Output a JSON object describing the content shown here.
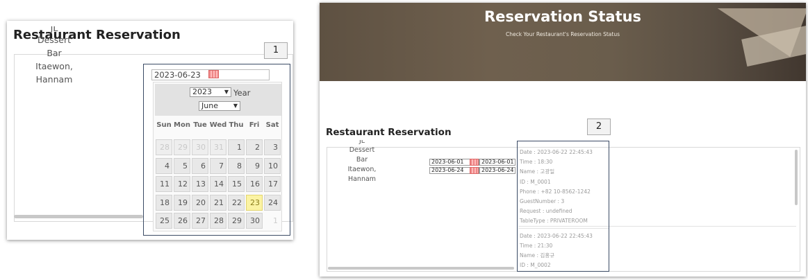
{
  "left_panel": {
    "title": "Restaurant Reservation",
    "restaurant_lines": [
      "JL",
      "Dessert",
      "Bar",
      "Itaewon,",
      "Hannam"
    ],
    "date_value": "2023-06-23",
    "callout": "1",
    "datepicker": {
      "year": "2023",
      "year_label": "Year",
      "month": "June",
      "weekdays": [
        "Sun",
        "Mon",
        "Tue",
        "Wed",
        "Thu",
        "Fri",
        "Sat"
      ],
      "days": [
        {
          "d": "28",
          "muted": true
        },
        {
          "d": "29",
          "muted": true
        },
        {
          "d": "30",
          "muted": true
        },
        {
          "d": "31",
          "muted": true
        },
        {
          "d": "1"
        },
        {
          "d": "2"
        },
        {
          "d": "3"
        },
        {
          "d": "4"
        },
        {
          "d": "5"
        },
        {
          "d": "6"
        },
        {
          "d": "7"
        },
        {
          "d": "8"
        },
        {
          "d": "9"
        },
        {
          "d": "10"
        },
        {
          "d": "11"
        },
        {
          "d": "12"
        },
        {
          "d": "13"
        },
        {
          "d": "14"
        },
        {
          "d": "15"
        },
        {
          "d": "16"
        },
        {
          "d": "17"
        },
        {
          "d": "18"
        },
        {
          "d": "19"
        },
        {
          "d": "20"
        },
        {
          "d": "21"
        },
        {
          "d": "22"
        },
        {
          "d": "23",
          "today": true
        },
        {
          "d": "24"
        },
        {
          "d": "25"
        },
        {
          "d": "26"
        },
        {
          "d": "27"
        },
        {
          "d": "28"
        },
        {
          "d": "29"
        },
        {
          "d": "30"
        },
        {
          "d": "1",
          "blank": true
        }
      ]
    }
  },
  "right_panel": {
    "hero_title": "Reservation Status",
    "hero_subtitle": "Check Your Restaurant's Reservation Status",
    "title": "Restaurant Reservation",
    "restaurant_lines": [
      "JL",
      "Dessert",
      "Bar",
      "Itaewon,",
      "Hannam"
    ],
    "date_rows": [
      {
        "from": "2023-06-01",
        "to": "2023-06-01"
      },
      {
        "from": "2023-06-24",
        "to": "2023-06-24"
      }
    ],
    "callout": "2",
    "reservations": [
      {
        "lines": [
          "Date : 2023-06-22 22:45:43",
          "Time : 18:30",
          "Name : 고광일",
          "ID : M_0001",
          "Phone : +82 10-8562-1242",
          "GuestNumber : 3",
          "Request : undefined",
          "TableType : PRIVATEROOM"
        ]
      },
      {
        "lines": [
          "Date : 2023-06-22 22:45:43",
          "Time : 21:30",
          "Name : 김홍규",
          "ID : M_0002"
        ]
      }
    ]
  },
  "colors": {
    "frame": "#3a4a64",
    "today_highlight": "#fbf3a3",
    "hero_bg": "#6a5d4c"
  }
}
